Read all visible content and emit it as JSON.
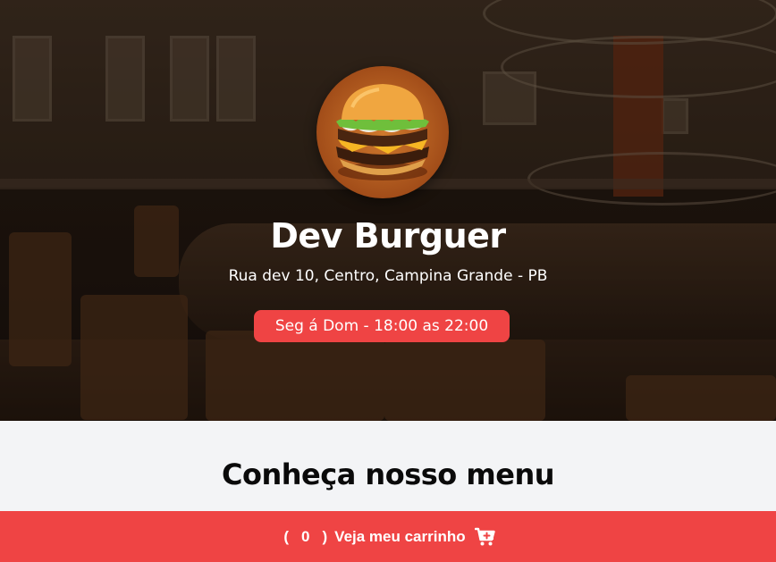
{
  "restaurant": {
    "name": "Dev Burguer",
    "address": "Rua dev 10, Centro, Campina Grande - PB",
    "hours": "Seg á Dom - 18:00 as 22:00",
    "logo_icon": "burger-logo"
  },
  "menu": {
    "title": "Conheça nosso menu"
  },
  "cart": {
    "open_paren": "(",
    "count": "0",
    "close_paren": ")",
    "label": "Veja meu carrinho",
    "icon": "cart-plus-icon"
  },
  "colors": {
    "accent": "#ef4444",
    "page_background": "#f3f4f6",
    "text_dark": "#0a0a0a"
  }
}
